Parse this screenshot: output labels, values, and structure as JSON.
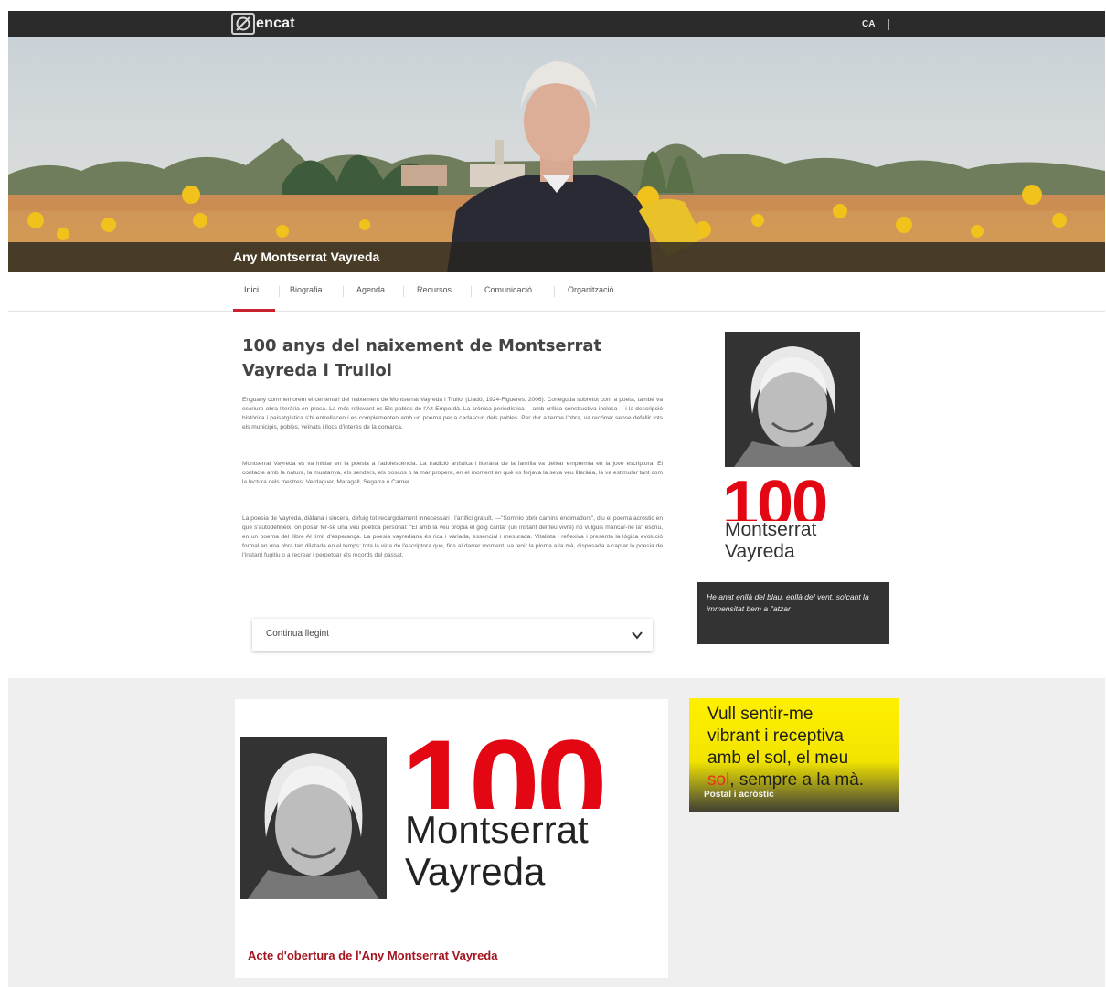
{
  "topbar": {
    "logo_text": "encat",
    "language": "CA"
  },
  "hero": {
    "title": "Any Montserrat Vayreda"
  },
  "nav": {
    "items": [
      "Inici",
      "Biografia",
      "Agenda",
      "Recursos",
      "Comunicació",
      "Organització"
    ],
    "active": "Inici"
  },
  "article": {
    "title": "100 anys del naixement de Montserrat Vayreda i Trullol",
    "paragraphs": [
      "Enguany commemorem el centenari del naixement de Montserrat Vayreda i Trullol (Lladó, 1924-Figueres, 2006). Coneguda sobretot com a poeta, també va escriure obra literària en prosa. La més rellevant és Els pobles de l'Alt Empordà. La crònica periodística —amb crítica constructiva inclosa— i la descripció històrica i paisatgística s'hi entrellacen i es complementen amb un poema per a cadascun dels pobles. Per dur a terme l'obra, va recórrer sense defallir tots els municipis, pobles, veïnats i llocs d'interès de la comarca.",
      "Montserrat Vayreda es va iniciar en la poesia a l'adolescència. La tradició artística i literària de la família va deixar empremta en la jove escriptora. El contacte amb la natura, la muntanya, els senders, els boscos o la mar propera, en el moment en què es forjava la seva veu literària, la va estimular tant com la lectura dels mestres: Verdaguer, Maragall, Segarra o Carner.",
      "La poesia de Vayreda, diàfana i sincera, defuig tot recargolament innecessari i l'artifici gratuït. —\"Somnio obrir camins encimadors\", diu el poema acròstic en què s'autodefineix, on posar fer-se una veu poètica personal: \"El amb la veu pròpia el goig cantar (un instant del teu vivre) no vulguis mancar-ne la\" escriu, en un poema del llibre Al límit d'esperança. La poesia vayrediana és rica i variada, essencial i mesurada. Vitalista i reflexiva i presenta la lògica evolució formal en una obra tan dilatada en el temps: tota la vida de l'escriptora que, fins al darrer moment, va tenir la ploma a la mà, disposada a captar la poesia de l'instant fugitiu o a recrear i perpetuar els records del passat."
    ],
    "continue_label": "Continua llegint"
  },
  "sidebar": {
    "hundred": "100",
    "name_line1": "Montserrat",
    "name_line2": "Vayreda",
    "quote": "He anat enllà del blau, enllà del vent, solcant la immensitat bem a l'atzar"
  },
  "card": {
    "hundred": "100",
    "name_line1": "Montserrat",
    "name_line2": "Vayreda",
    "caption": "Acte d'obertura de l'Any Montserrat Vayreda"
  },
  "promo": {
    "line1": "Vull sentir-me",
    "line2": "vibrant i receptiva",
    "line3": "amb el sol, el meu",
    "line4_highlight": "sol",
    "line4_rest": ", sempre a la mà.",
    "label": "Postal i acròstic"
  },
  "colors": {
    "accent_red": "#e30613",
    "caption_red": "#a3151f",
    "topbar": "#2b2b2b",
    "promo_yellow": "#fff000"
  }
}
